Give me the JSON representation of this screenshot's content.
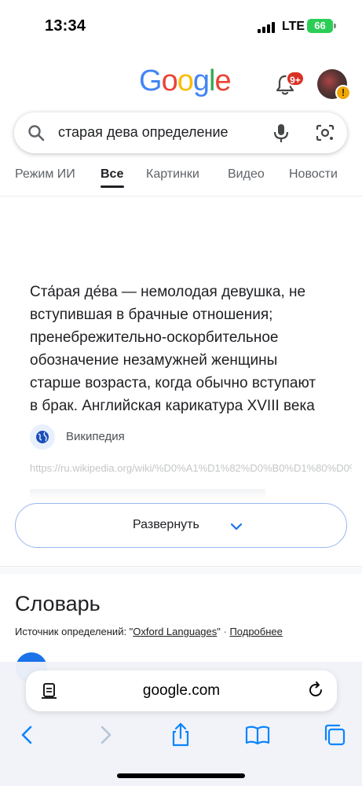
{
  "status_bar": {
    "time": "13:34",
    "network": "LTE",
    "battery": "66"
  },
  "header": {
    "logo_letters": [
      {
        "char": "G",
        "color": "#4285F4"
      },
      {
        "char": "o",
        "color": "#EA4335"
      },
      {
        "char": "o",
        "color": "#FBBC05"
      },
      {
        "char": "g",
        "color": "#4285F4"
      },
      {
        "char": "l",
        "color": "#34A853"
      },
      {
        "char": "e",
        "color": "#EA4335"
      }
    ],
    "notification_badge": "9+",
    "account_alert": "!"
  },
  "search": {
    "query": "старая дева определение"
  },
  "tabs": [
    {
      "label": "Режим ИИ",
      "active": false
    },
    {
      "label": "Все",
      "active": true
    },
    {
      "label": "Картинки",
      "active": false
    },
    {
      "label": "Видео",
      "active": false
    },
    {
      "label": "Новости",
      "active": false
    }
  ],
  "snippet": {
    "lines": [
      "Ста́рая де́ва — немолодая девушка, не",
      "вступившая в брачные отношения;",
      "пренебрежительно-оскорбительное",
      "обозначение незамужней женщины",
      "старше возраста, когда обычно вступают",
      "в брак. Английская карикатура XVIII века"
    ],
    "source_name": "Википедия",
    "source_url": "https://ru.wikipedia.org/wiki/%D0%A1%D1%82%D0%B0%D1%80%D0%B0%D1%8F"
  },
  "expand_button": {
    "label": "Развернуть"
  },
  "dictionary": {
    "title": "Словарь",
    "source_prefix": "Источник определений: \"",
    "source_name": "Oxford Languages",
    "source_suffix": "\"",
    "separator": " · ",
    "more_link": "Подробнее"
  },
  "browser": {
    "address": "google.com"
  },
  "colors": {
    "accent_blue": "#1a73e8",
    "badge_red": "#d93025",
    "battery_green": "#2ccd56",
    "toolbar_blue": "#0a84ff"
  }
}
